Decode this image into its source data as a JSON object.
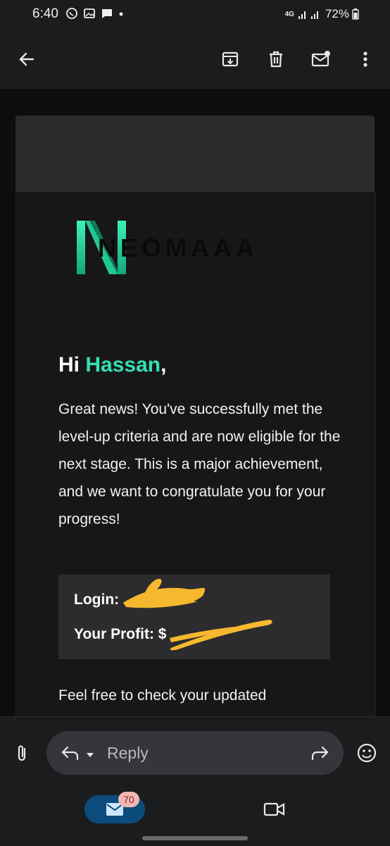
{
  "status_bar": {
    "time": "6:40",
    "network": "4G",
    "battery": "72%"
  },
  "app_bar": {
    "icons": [
      "back-arrow-icon",
      "archive-icon",
      "delete-icon",
      "mark-unread-icon",
      "more-vert-icon"
    ]
  },
  "email": {
    "brand": "NEOMAAA",
    "greeting_prefix": "Hi ",
    "greeting_name": "Hassan",
    "greeting_suffix": ",",
    "body": "Great news! You've successfully met the level-up criteria and are now eligible for the next stage. This is a major achievement, and we want to congratulate you for your progress!",
    "login_label": "Login: ",
    "profit_label": "Your Profit: $",
    "body_continued": "Feel free to check your updated"
  },
  "reply_bar": {
    "reply_label": "Reply"
  },
  "bottom_nav": {
    "mail_badge": "70"
  },
  "colors": {
    "accent": "#33e0b2",
    "redaction": "#f5b82e",
    "mail_pill": "#0b4c7c"
  }
}
